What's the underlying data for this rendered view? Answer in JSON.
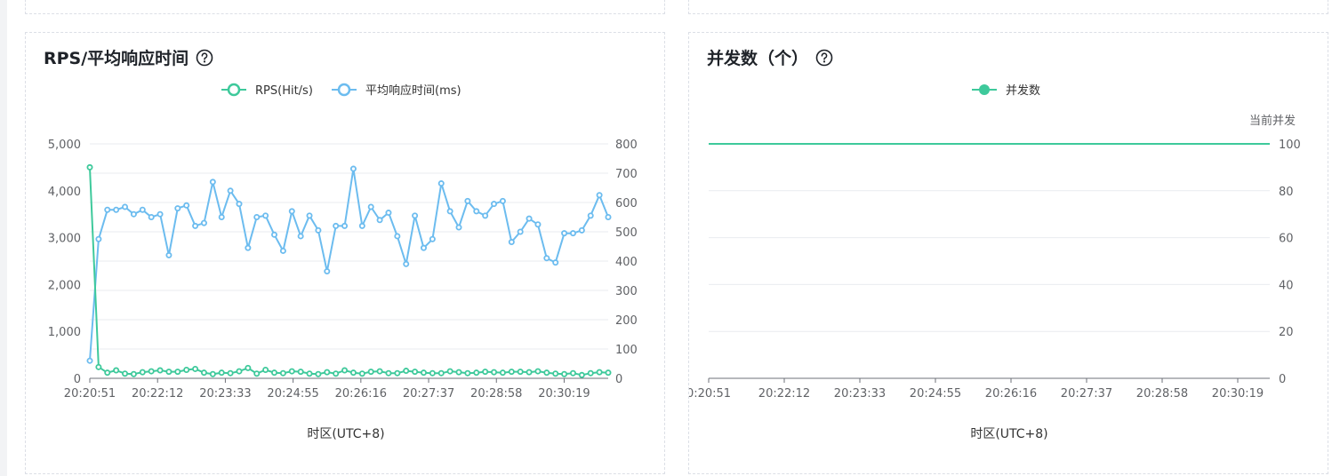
{
  "colors": {
    "rps": "#3ec99b",
    "avg": "#6cbcef",
    "concurrency": "#3ec99b",
    "grid": "#e9ebef",
    "axis_text": "#606266"
  },
  "panels": {
    "rps": {
      "title": "RPS/平均响应时间",
      "help_icon": "question-circle-icon"
    },
    "concurrency": {
      "title": "并发数（个）",
      "help_icon": "question-circle-icon"
    }
  },
  "chart_data": [
    {
      "type": "line",
      "title": "RPS/平均响应时间",
      "xlabel": "时区(UTC+8)",
      "x_ticks": [
        "20:20:51",
        "20:22:12",
        "20:23:33",
        "20:24:55",
        "20:26:16",
        "20:27:37",
        "20:28:58",
        "20:30:19"
      ],
      "ylim": [
        0,
        5000
      ],
      "y_ticks": [
        "5,000",
        "4,000",
        "3,000",
        "2,000",
        "1,000",
        "0"
      ],
      "y2lim": [
        0,
        800
      ],
      "y2_ticks": [
        "800",
        "700",
        "600",
        "500",
        "400",
        "300",
        "200",
        "100",
        "0"
      ],
      "legend": "top-center",
      "series": [
        {
          "name": "RPS(Hit/s)",
          "axis": "left",
          "values": [
            4500,
            240,
            120,
            170,
            100,
            90,
            130,
            150,
            170,
            140,
            140,
            180,
            200,
            120,
            90,
            120,
            110,
            150,
            220,
            100,
            180,
            120,
            110,
            150,
            140,
            100,
            90,
            130,
            100,
            170,
            120,
            100,
            140,
            150,
            110,
            110,
            160,
            140,
            120,
            110,
            110,
            150,
            130,
            110,
            120,
            140,
            130,
            120,
            140,
            140,
            130,
            150,
            120,
            100,
            90,
            110,
            70,
            110,
            130,
            120
          ]
        },
        {
          "name": "平均响应时间(ms)",
          "axis": "right",
          "values": [
            60,
            475,
            575,
            575,
            585,
            560,
            575,
            550,
            560,
            420,
            580,
            590,
            520,
            530,
            670,
            550,
            640,
            595,
            445,
            550,
            555,
            490,
            435,
            570,
            485,
            555,
            505,
            365,
            520,
            520,
            715,
            520,
            585,
            540,
            565,
            485,
            390,
            555,
            445,
            475,
            665,
            570,
            515,
            605,
            570,
            555,
            595,
            605,
            465,
            500,
            545,
            525,
            410,
            395,
            495,
            495,
            505,
            555,
            625,
            550
          ]
        }
      ]
    },
    {
      "type": "line",
      "title": "并发数（个）",
      "xlabel": "时区(UTC+8)",
      "ylabel": "当前并发",
      "x_ticks": [
        "0:20:51",
        "20:22:12",
        "20:23:33",
        "20:24:55",
        "20:26:16",
        "20:27:37",
        "20:28:58",
        "20:30:19"
      ],
      "ylim": [
        0,
        100
      ],
      "y_ticks": [
        "100",
        "80",
        "60",
        "40",
        "20",
        "0"
      ],
      "legend": "top-center",
      "series": [
        {
          "name": "并发数",
          "values": [
            100,
            100,
            100,
            100,
            100,
            100,
            100,
            100
          ]
        }
      ]
    }
  ]
}
